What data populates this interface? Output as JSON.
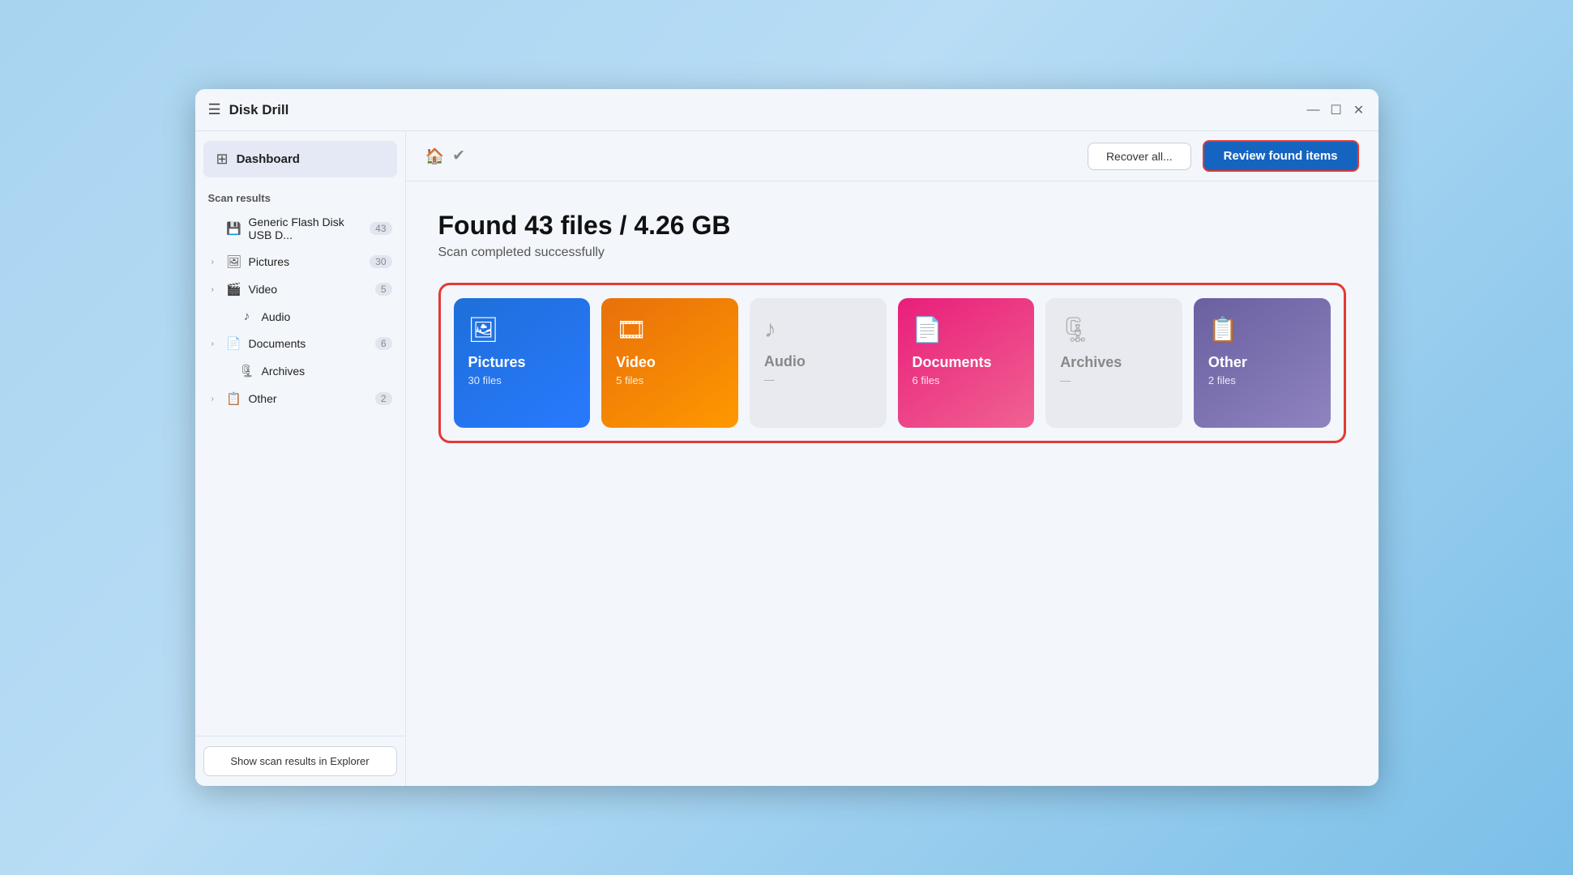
{
  "app": {
    "title": "Disk Drill",
    "window_buttons": {
      "minimize": "—",
      "maximize": "☐",
      "close": "✕"
    }
  },
  "sidebar": {
    "dashboard_label": "Dashboard",
    "scan_results_label": "Scan results",
    "items": [
      {
        "id": "device",
        "label": "Generic Flash Disk USB D...",
        "count": "43",
        "indent": false,
        "has_chevron": false,
        "icon": "💾"
      },
      {
        "id": "pictures",
        "label": "Pictures",
        "count": "30",
        "indent": false,
        "has_chevron": true,
        "icon": "🖼"
      },
      {
        "id": "video",
        "label": "Video",
        "count": "5",
        "indent": false,
        "has_chevron": true,
        "icon": "🎬"
      },
      {
        "id": "audio",
        "label": "Audio",
        "count": "",
        "indent": true,
        "has_chevron": false,
        "icon": "♪"
      },
      {
        "id": "documents",
        "label": "Documents",
        "count": "6",
        "indent": false,
        "has_chevron": true,
        "icon": "📄"
      },
      {
        "id": "archives",
        "label": "Archives",
        "count": "",
        "indent": true,
        "has_chevron": false,
        "icon": "🗜"
      },
      {
        "id": "other",
        "label": "Other",
        "count": "2",
        "indent": false,
        "has_chevron": true,
        "icon": "📋"
      }
    ],
    "footer": {
      "show_explorer_label": "Show scan results in Explorer"
    }
  },
  "topbar": {
    "recover_all_label": "Recover all...",
    "review_label": "Review found items"
  },
  "main": {
    "found_title": "Found 43 files / 4.26 GB",
    "scan_status": "Scan completed successfully",
    "cards": [
      {
        "id": "pictures",
        "icon": "🖼",
        "label": "Pictures",
        "count": "30 files",
        "type": "pictures"
      },
      {
        "id": "video",
        "icon": "🎞",
        "label": "Video",
        "count": "5 files",
        "type": "video"
      },
      {
        "id": "audio",
        "icon": "♪",
        "label": "Audio",
        "count": "—",
        "type": "audio"
      },
      {
        "id": "documents",
        "icon": "📄",
        "label": "Documents",
        "count": "6 files",
        "type": "documents"
      },
      {
        "id": "archives",
        "icon": "🗜",
        "label": "Archives",
        "count": "—",
        "type": "archives"
      },
      {
        "id": "other",
        "icon": "📋",
        "label": "Other",
        "count": "2 files",
        "type": "other"
      }
    ]
  }
}
